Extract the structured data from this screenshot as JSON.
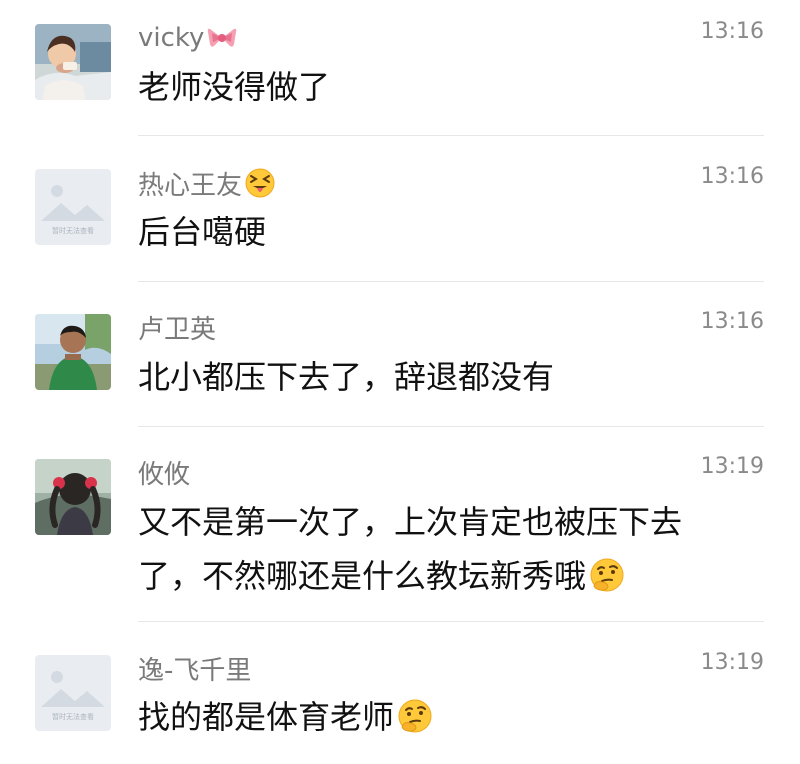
{
  "comments": [
    {
      "user": "vicky",
      "name_emoji": "ribbon-emoji",
      "time": "13:16",
      "text": "老师没得做了",
      "text_emoji": "",
      "avatar": "photo-avatar-child-drinking"
    },
    {
      "user": "热心王友",
      "name_emoji": "tongue-out-emoji",
      "time": "13:16",
      "text": "后台噶硬",
      "text_emoji": "",
      "avatar": "placeholder-avatar",
      "avatar_caption": "暂时无法查看"
    },
    {
      "user": "卢卫英",
      "name_emoji": "",
      "time": "13:16",
      "text": "北小都压下去了，辞退都没有",
      "text_emoji": "",
      "avatar": "photo-avatar-boy-outdoors"
    },
    {
      "user": "攸攸",
      "name_emoji": "",
      "time": "13:19",
      "text_line1": "又不是第一次了，上次肯定也被压下去",
      "text_line2": "了，不然哪还是什么教坛新秀哦",
      "text_emoji": "thinking-face-emoji",
      "avatar": "photo-avatar-girl-braids"
    },
    {
      "user": "逸-飞千里",
      "name_emoji": "",
      "time": "13:19",
      "text": "找的都是体育老师",
      "text_emoji": "thinking-face-emoji",
      "avatar": "placeholder-avatar",
      "avatar_caption": "暂时无法查看"
    }
  ],
  "colors": {
    "name": "#7a7a7a",
    "time": "#8a8a8a",
    "text": "#111111",
    "divider": "#e7e7e7"
  }
}
